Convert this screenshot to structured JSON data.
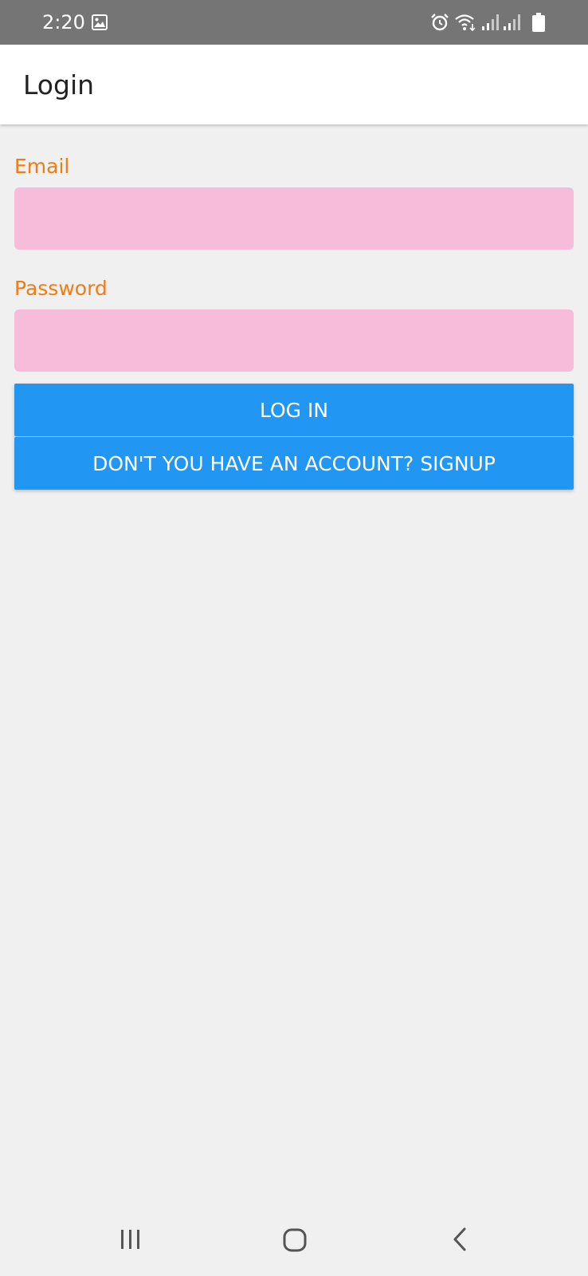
{
  "status_bar": {
    "time": "2:20",
    "icons": [
      "image-icon",
      "alarm-icon",
      "wifi-icon",
      "signal-icon",
      "signal-icon",
      "battery-icon"
    ]
  },
  "app_bar": {
    "title": "Login"
  },
  "form": {
    "email_label": "Email",
    "email_value": "",
    "password_label": "Password",
    "password_value": "",
    "login_button": "LOG IN",
    "signup_button": "DON'T YOU HAVE AN ACCOUNT? SIGNUP"
  },
  "nav_bar": {
    "icons": [
      "recent-apps-icon",
      "home-icon",
      "back-icon"
    ]
  },
  "colors": {
    "status_bar": "#757575",
    "label_accent": "#ef7d14",
    "input_background": "#f7bcda",
    "button_primary": "#2196f3",
    "page_background": "#f0f0f0"
  }
}
